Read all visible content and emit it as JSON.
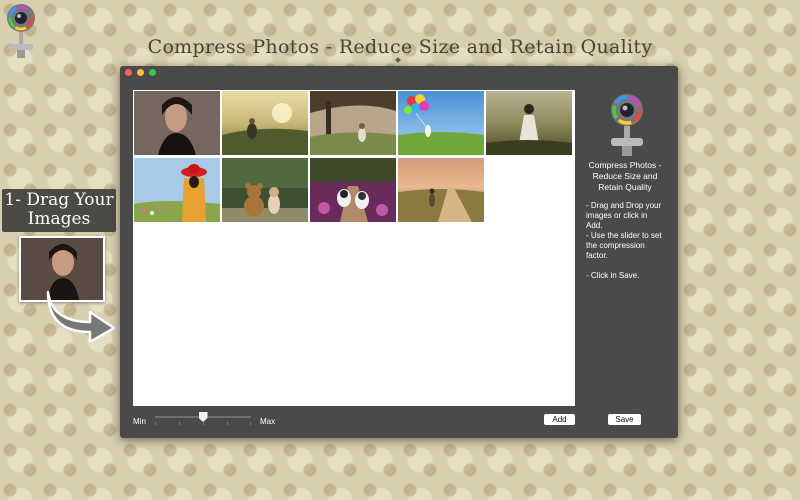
{
  "promo": {
    "title": "Compress Photos - Reduce Size and Retain Quality",
    "step_label_line1": "1- Drag Your",
    "step_label_line2": "Images"
  },
  "window": {
    "panel": {
      "heading_line1": "Compress Photos -",
      "heading_line2": "Reduce Size and",
      "heading_line3": "Retain Quality",
      "instruction_line1": "- Drag and Drop your",
      "instruction_line2": "images or click in",
      "instruction_line3": "Add.",
      "instruction_line4": "- Use the slider to set",
      "instruction_line5": "the compression",
      "instruction_line6": "factor.",
      "instruction_line7": "- Click in Save."
    },
    "slider": {
      "min_label": "Min",
      "max_label": "Max",
      "value_fraction": 0.5
    },
    "buttons": {
      "add_label": "Add",
      "save_label": "Save"
    },
    "thumbnails": [
      {
        "subject": "woman-portrait"
      },
      {
        "subject": "man-sitting-sunset"
      },
      {
        "subject": "woman-under-tree"
      },
      {
        "subject": "girl-with-balloons"
      },
      {
        "subject": "woman-in-field"
      },
      {
        "subject": "woman-red-hat"
      },
      {
        "subject": "child-with-teddy-bear"
      },
      {
        "subject": "dogs-on-path"
      },
      {
        "subject": "woman-on-country-road"
      }
    ]
  },
  "colors": {
    "window_bg": "#4a4a4a",
    "canvas_bg": "#ffffff",
    "close": "#fc605c",
    "minimize": "#fdbc40",
    "maximize": "#34c84a"
  }
}
